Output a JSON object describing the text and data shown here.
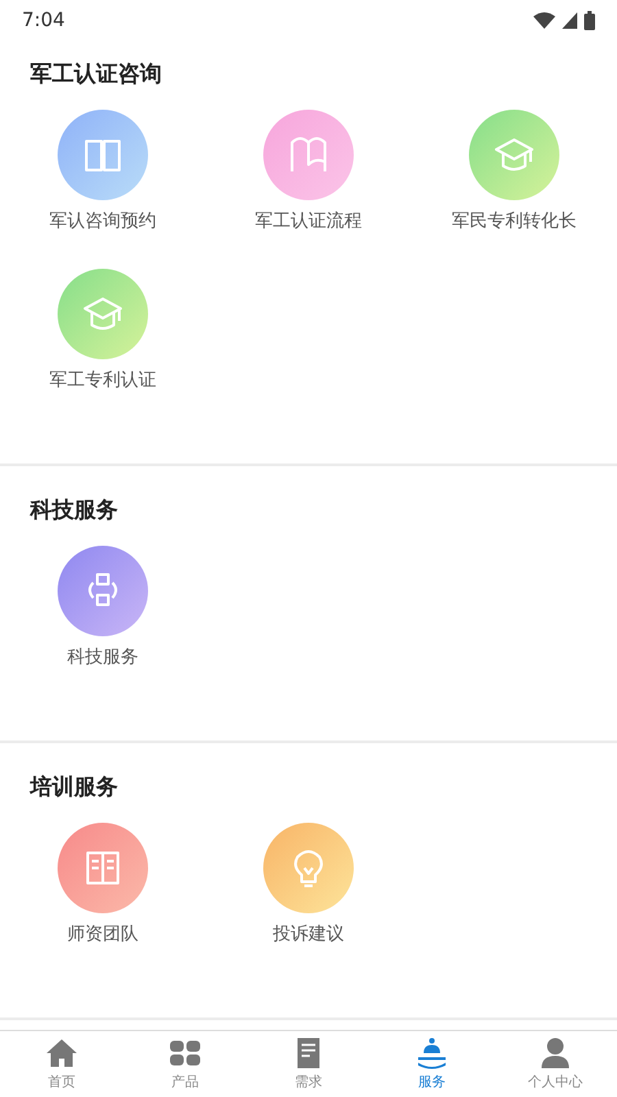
{
  "status_bar": {
    "time": "7:04"
  },
  "sections": [
    {
      "title": "军工认证咨询",
      "items": [
        {
          "label": "军认咨询预约",
          "kind": "book"
        },
        {
          "label": "军工认证流程",
          "kind": "openbook"
        },
        {
          "label": "军民专利转化长",
          "kind": "cap"
        },
        {
          "label": "军工专利认证",
          "kind": "cap"
        }
      ]
    },
    {
      "title": "科技服务",
      "items": [
        {
          "label": "科技服务",
          "kind": "sync"
        }
      ]
    },
    {
      "title": "培训服务",
      "items": [
        {
          "label": "师资团队",
          "kind": "panel"
        },
        {
          "label": "投诉建议",
          "kind": "bulb"
        }
      ]
    }
  ],
  "tab_bar": [
    {
      "label": "首页",
      "kind": "home",
      "selected": false
    },
    {
      "label": "产品",
      "kind": "grid",
      "selected": false
    },
    {
      "label": "需求",
      "kind": "doc",
      "selected": false
    },
    {
      "label": "服务",
      "kind": "service",
      "selected": true
    },
    {
      "label": "个人中心",
      "kind": "person",
      "selected": false
    }
  ]
}
